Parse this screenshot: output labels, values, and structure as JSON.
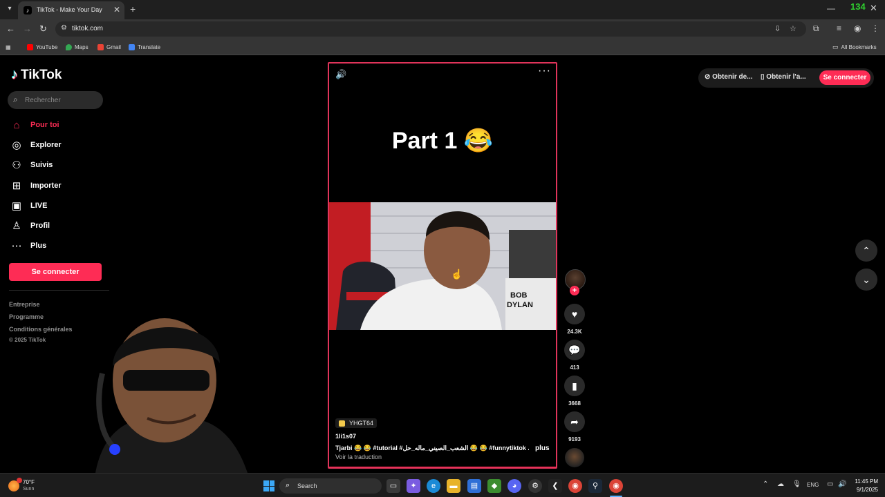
{
  "browser": {
    "tab_title": "TikTok - Make Your Day",
    "url": "tiktok.com",
    "overlay_counter": "134",
    "bookmarks": [
      {
        "label": "YouTube",
        "icon": "youtube-icon",
        "color": "#ff0000"
      },
      {
        "label": "Maps",
        "icon": "maps-icon",
        "color": "#34a853"
      },
      {
        "label": "Gmail",
        "icon": "gmail-icon",
        "color": "#ea4335"
      },
      {
        "label": "Translate",
        "icon": "translate-icon",
        "color": "#4285f4"
      }
    ],
    "all_bookmarks": "All Bookmarks"
  },
  "tiktok": {
    "brand": "TikTok",
    "search_placeholder": "Rechercher",
    "nav": [
      {
        "label": "Pour toi",
        "icon": "home-icon",
        "active": true
      },
      {
        "label": "Explorer",
        "icon": "compass-icon"
      },
      {
        "label": "Suivis",
        "icon": "following-icon"
      },
      {
        "label": "Importer",
        "icon": "upload-icon"
      },
      {
        "label": "LIVE",
        "icon": "live-icon"
      },
      {
        "label": "Profil",
        "icon": "profile-icon"
      },
      {
        "label": "Plus",
        "icon": "more-icon"
      }
    ],
    "login_label": "Se connecter",
    "footer": [
      "Entreprise",
      "Programme",
      "Conditions générales"
    ],
    "copyright": "© 2025 TikTok",
    "top_actions": {
      "get_coins": "Obtenir de...",
      "get_app": "Obtenir l'a...",
      "login": "Se connecter"
    },
    "accent_color": "#fe2c55"
  },
  "video": {
    "overlay_text": "Part 1 😂",
    "author_badge": "YHGT64",
    "handle": "1li1s07",
    "caption": "Tjarbi 😂 😂 #tutorial #الشعب_الصيني_ماله_حل 😂 😂 #funnytiktok ...",
    "more": "plus",
    "translate": "Voir la traduction",
    "likes": "24.3K",
    "comments": "413",
    "saves": "3668",
    "shares": "9193"
  },
  "taskbar": {
    "weather_temp": "70°F",
    "weather_desc": "Sunn",
    "search_label": "Search",
    "language": "ENG",
    "time": "11:45 PM",
    "date": "9/1/2025"
  }
}
